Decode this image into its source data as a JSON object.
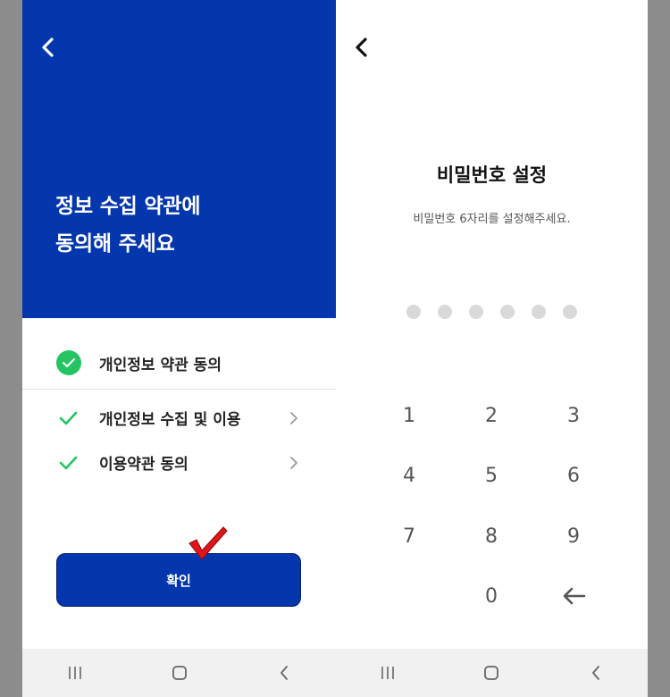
{
  "left_screen": {
    "title_line1": "정보 수집 약관에",
    "title_line2": "동의해 주세요",
    "agree_all_label": "개인정보 약관 동의",
    "items": [
      {
        "label": "개인정보 수집 및 이용"
      },
      {
        "label": "이용약관 동의"
      }
    ],
    "confirm_label": "확인"
  },
  "right_screen": {
    "title": "비밀번호 설정",
    "subtitle": "비밀번호 6자리를 설정해주세요.",
    "pin_length": 6,
    "keys": [
      "1",
      "2",
      "3",
      "4",
      "5",
      "6",
      "7",
      "8",
      "9",
      "0"
    ]
  },
  "colors": {
    "brand_blue": "#0437ad",
    "check_green": "#24c463",
    "pin_dot": "#d9d9d9",
    "annotation_red": "#e0151b"
  },
  "icons": {
    "back": "chevron-left-icon",
    "check": "check-icon",
    "chevron": "chevron-right-icon",
    "backspace": "arrow-left-icon",
    "nav_recents": "recents-icon",
    "nav_home": "home-icon",
    "nav_back": "nav-back-icon"
  }
}
